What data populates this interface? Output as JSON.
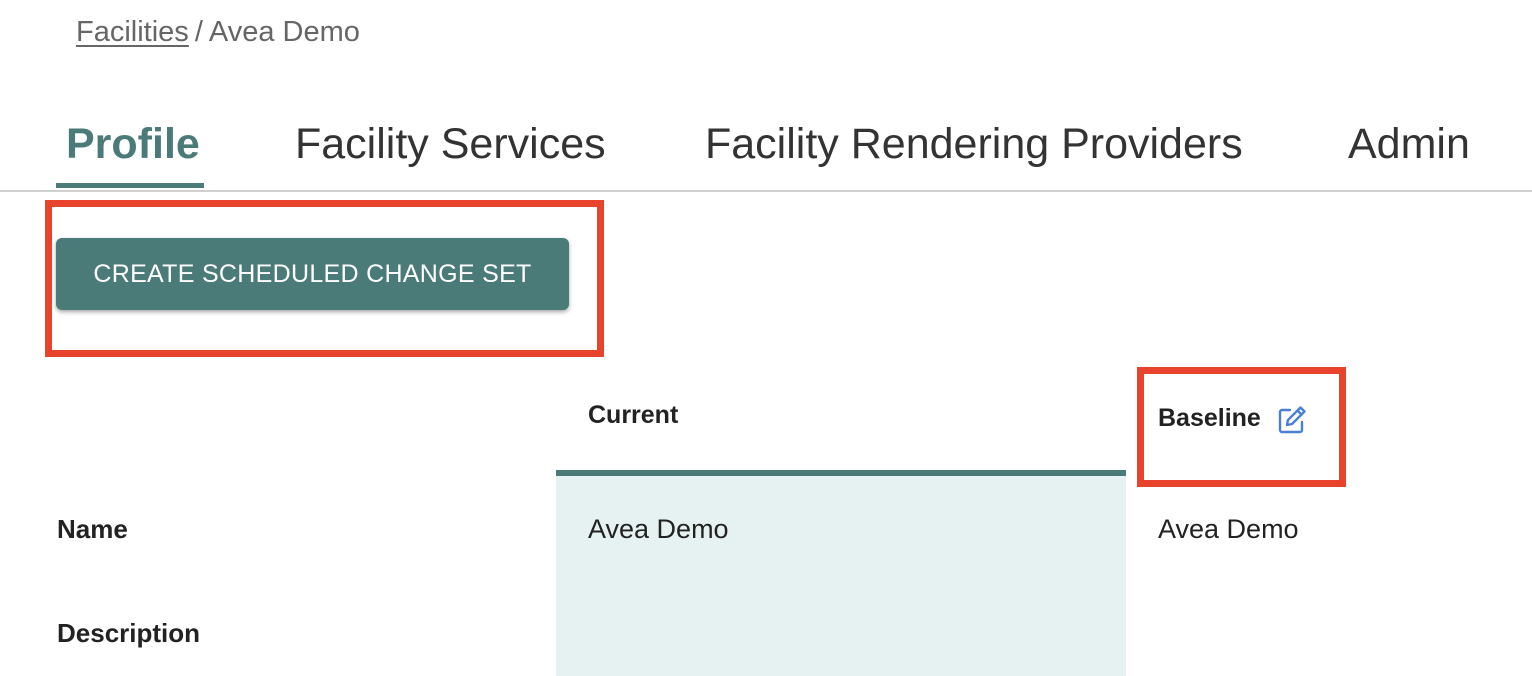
{
  "breadcrumb": {
    "parent": "Facilities",
    "separator": "/",
    "current": "Avea Demo"
  },
  "tabs": [
    {
      "label": "Profile",
      "active": true
    },
    {
      "label": "Facility Services",
      "active": false
    },
    {
      "label": "Facility Rendering Providers",
      "active": false
    },
    {
      "label": "Admin",
      "active": false
    }
  ],
  "actions": {
    "create_label": "CREATE SCHEDULED CHANGE SET"
  },
  "table": {
    "columns": {
      "current": "Current",
      "baseline": "Baseline"
    },
    "rows": [
      {
        "label": "Name",
        "current": "Avea Demo",
        "baseline": "Avea Demo"
      },
      {
        "label": "Description",
        "current": "",
        "baseline": ""
      }
    ]
  },
  "icons": {
    "edit": "edit-icon"
  },
  "colors": {
    "accent": "#4b7b78",
    "current_band": "#e6f2f1",
    "highlight": "#e8432c",
    "edit_icon": "#4a7fd6"
  }
}
